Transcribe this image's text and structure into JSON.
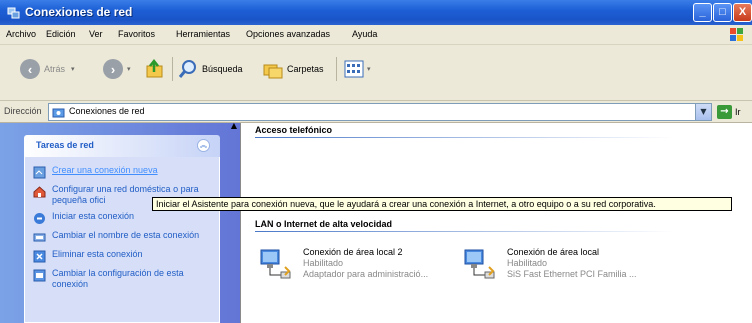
{
  "window": {
    "title": "Conexiones de red",
    "buttons": {
      "minimize": "_",
      "maximize": "□",
      "close": "X"
    }
  },
  "menubar": [
    "Archivo",
    "Edición",
    "Ver",
    "Favoritos",
    "Herramientas",
    "Opciones avanzadas",
    "Ayuda"
  ],
  "toolbar": {
    "back_label": "Atrás",
    "search_label": "Búsqueda",
    "folders_label": "Carpetas"
  },
  "address": {
    "label": "Dirección",
    "value": "Conexiones de red",
    "go_label": "Ir"
  },
  "tasks": {
    "header": "Tareas de red",
    "items": [
      {
        "label": "Crear una conexión nueva",
        "icon": "new-connection-icon"
      },
      {
        "label": "Configurar una red doméstica o para pequeña ofici",
        "icon": "home-network-icon"
      },
      {
        "label": "Iniciar esta conexión",
        "icon": "start-connection-icon"
      },
      {
        "label": "Cambiar el nombre de esta conexión",
        "icon": "rename-icon"
      },
      {
        "label": "Eliminar esta conexión",
        "icon": "delete-icon"
      },
      {
        "label": "Cambiar la configuración de esta conexión",
        "icon": "settings-icon"
      }
    ]
  },
  "content": {
    "group_dialup": "Acceso telefónico",
    "group_lan": "LAN o Internet de alta velocidad",
    "connections": [
      {
        "name": "Conexión de área local 2",
        "status": "Habilitado",
        "device": "Adaptador para administració..."
      },
      {
        "name": "Conexión de área local",
        "status": "Habilitado",
        "device": "SiS Fast Ethernet PCI Familia ..."
      }
    ]
  },
  "tooltip": "Iniciar el Asistente para conexión nueva, que le ayudará a crear una conexión a Internet, a otro equipo o a su red corporativa."
}
